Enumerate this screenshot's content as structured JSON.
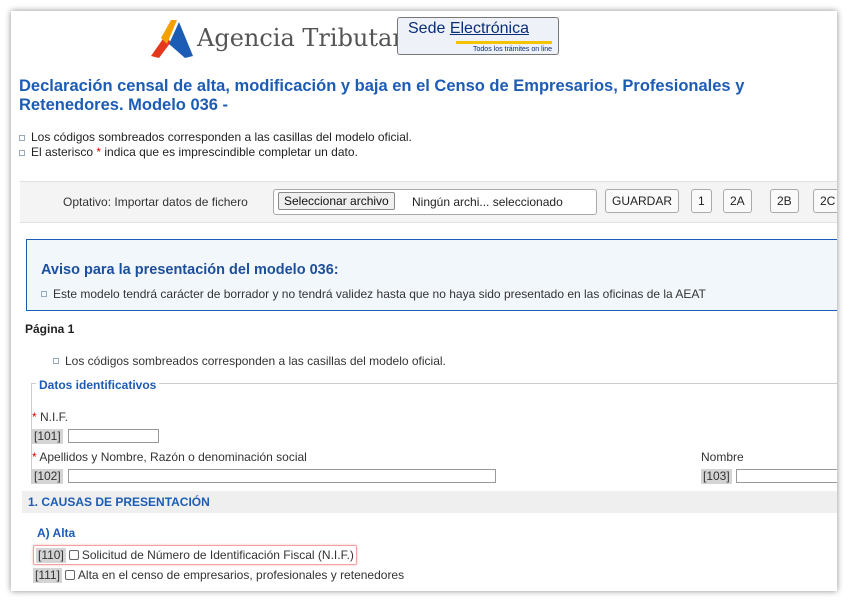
{
  "header": {
    "agency_name": "Agencia Tributaria",
    "sede_title_part1": "Sede ",
    "sede_title_part2": "Electrónica",
    "sede_subtitle": "Todos los trámites on line"
  },
  "title": "Declaración censal de alta, modificación y baja en el Censo de Empresarios, Profesionales y Retenedores. Modelo 036 -",
  "notes": [
    "Los códigos sombreados corresponden a las casillas del modelo oficial.",
    {
      "before": "El asterisco ",
      "star": "*",
      "after": " indica que es imprescindible completar un dato."
    }
  ],
  "toolbar": {
    "import_label": "Optativo: Importar datos de fichero",
    "file_button": "Seleccionar archivo",
    "file_status": "Ningún archi... seleccionado",
    "save_button": "GUARDAR",
    "page_buttons": [
      "1",
      "2A",
      "2B",
      "2C"
    ]
  },
  "notice": {
    "title": "Aviso para la presentación del modelo 036:",
    "text": "Este modelo tendrá carácter de borrador y no tendrá validez hasta que no haya sido presentado en las oficinas de la AEAT"
  },
  "page": {
    "label": "Página 1",
    "note": "Los códigos sombreados corresponden a las casillas del modelo oficial."
  },
  "datos": {
    "legend": "Datos identificativos",
    "star": "*",
    "nif_label": "N.I.F.",
    "nif_code": "[101]",
    "nif_value": "",
    "apellidos_label": "Apellidos y Nombre, Razón o denominación social",
    "apellidos_code": "[102]",
    "apellidos_value": "",
    "nombre_label": "Nombre",
    "nombre_code": "[103]",
    "nombre_value": ""
  },
  "causas": {
    "title": "1. CAUSAS DE PRESENTACIÓN",
    "alta_label": "A) Alta",
    "options": [
      {
        "code": "[110]",
        "label": "Solicitud de Número de Identificación Fiscal (N.I.F.)",
        "checked": false
      },
      {
        "code": "[111]",
        "label": "Alta en el censo de empresarios, profesionales y retenedores",
        "checked": false
      }
    ]
  },
  "colors": {
    "heading_blue": "#1d5cb5",
    "required_red": "#d00000",
    "code_gray": "#d4d4d4"
  }
}
